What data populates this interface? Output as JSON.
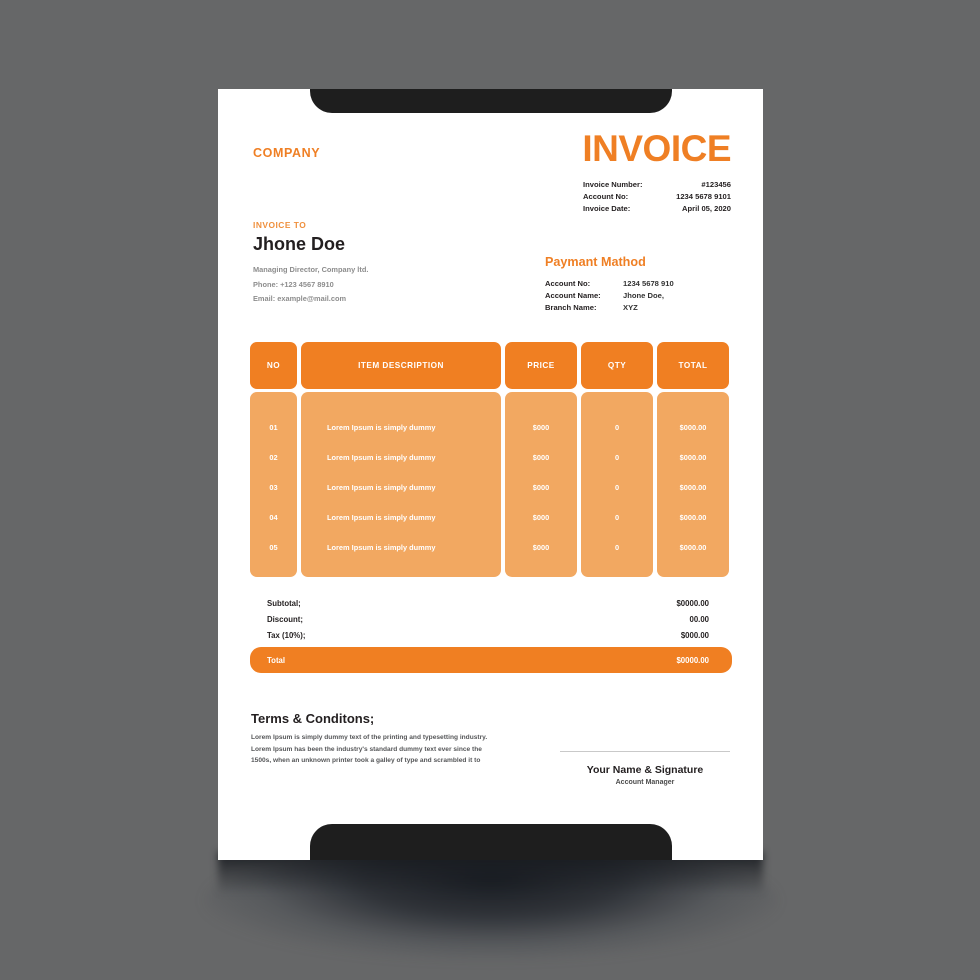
{
  "colors": {
    "background": "#666768",
    "sheet": "#ffffff",
    "accent": "#ef7f24",
    "table_header": "#f07f22",
    "table_body": "#f2a861",
    "dark_bar": "#1e1e1e"
  },
  "header": {
    "company_name": "COMPANY",
    "invoice_title": "INVOICE",
    "meta": [
      {
        "label": "Invoice Number:",
        "value": "#123456"
      },
      {
        "label": "Account No:",
        "value": "1234 5678 9101"
      },
      {
        "label": "Invoice Date:",
        "value": "April 05, 2020"
      }
    ]
  },
  "bill_to": {
    "label": "INVOICE TO",
    "name": "Jhone Doe",
    "lines": [
      "Managing Director, Company ltd.",
      "Phone: +123 4567 8910",
      "Email: example@mail.com"
    ]
  },
  "payment_method": {
    "title": "Paymant Mathod",
    "rows": [
      {
        "label": "Account No:",
        "value": "1234 5678 910"
      },
      {
        "label": "Account Name:",
        "value": "Jhone Doe,"
      },
      {
        "label": "Branch Name:",
        "value": "XYZ"
      }
    ]
  },
  "items_table": {
    "columns": [
      "NO",
      "ITEM DESCRIPTION",
      "PRICE",
      "QTY",
      "TOTAL"
    ],
    "rows": [
      {
        "no": "01",
        "description": "Lorem Ipsum is simply dummy",
        "price": "$000",
        "qty": "0",
        "total": "$000.00"
      },
      {
        "no": "02",
        "description": "Lorem Ipsum is simply dummy",
        "price": "$000",
        "qty": "0",
        "total": "$000.00"
      },
      {
        "no": "03",
        "description": "Lorem Ipsum is simply dummy",
        "price": "$000",
        "qty": "0",
        "total": "$000.00"
      },
      {
        "no": "04",
        "description": "Lorem Ipsum is simply dummy",
        "price": "$000",
        "qty": "0",
        "total": "$000.00"
      },
      {
        "no": "05",
        "description": "Lorem Ipsum is simply dummy",
        "price": "$000",
        "qty": "0",
        "total": "$000.00"
      }
    ]
  },
  "summary": {
    "rows": [
      {
        "label": "Subtotal;",
        "value": "$0000.00"
      },
      {
        "label": "Discount;",
        "value": "00.00"
      },
      {
        "label": "Tax (10%);",
        "value": "$000.00"
      }
    ],
    "total": {
      "label": "Total",
      "value": "$0000.00"
    }
  },
  "terms": {
    "title": "Terms & Conditons;",
    "lines": [
      "Lorem Ipsum is simply dummy text of the printing and typesetting industry.",
      "Lorem Ipsum has been the industry's standard dummy text ever since the",
      "1500s, when an unknown printer took a galley of type and scrambled it to"
    ]
  },
  "signature": {
    "name": "Your Name & Signature",
    "role": "Account Manager"
  }
}
